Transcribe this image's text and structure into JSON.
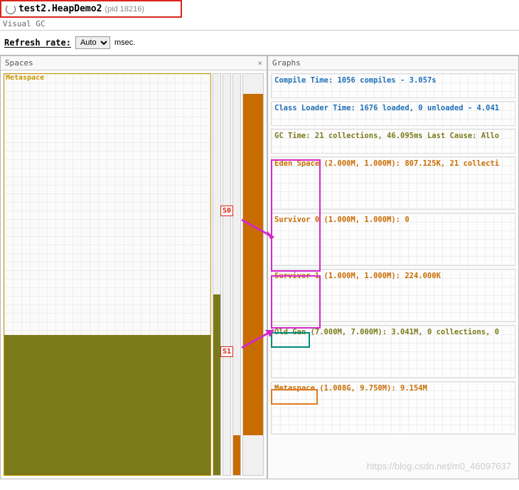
{
  "title": {
    "name": "test2.HeapDemo2",
    "pid": "(pid 18216)"
  },
  "section": "Visual GC",
  "refresh": {
    "label": "Refresh rate:",
    "value": "Auto",
    "unit": "msec."
  },
  "panels": {
    "spaces_title": "Spaces",
    "graphs_title": "Graphs",
    "metaspace_label": "Metaspace"
  },
  "labels": {
    "s0": "S0",
    "s1": "S1"
  },
  "graphs": {
    "compile": {
      "label": "Compile Time:",
      "detail": " 1056 compiles - 3.057s"
    },
    "classloader": {
      "label": "Class Loader Time:",
      "detail": " 1676 loaded, 0 unloaded - 4.041"
    },
    "gctime": {
      "label": "GC Time:",
      "detail": " 21 collections, 46.095ms Last Cause: Allo"
    },
    "eden": {
      "label": "Eden Space",
      "detail": " (2.000M, 1.000M): 807.125K, 21 collecti"
    },
    "s0": {
      "label": "Survivor 0",
      "detail": " (1.000M, 1.000M): 0"
    },
    "s1": {
      "label": "Survivor 1",
      "detail": " (1.000M, 1.000M): 224.000K"
    },
    "oldgen": {
      "label": "Old Gen",
      "detail": " (7.000M, 7.000M): 3.041M, 0 collections, 0"
    },
    "metaspace": {
      "label": "Metaspace",
      "detail": " (1.008G, 9.750M): 9.154M"
    }
  },
  "chart_data": {
    "type": "bar",
    "title": "JVM Heap Spaces",
    "series": [
      {
        "name": "Metaspace",
        "capacity_mb": 9.75,
        "used_mb": 9.154,
        "max_gb": 1.008
      },
      {
        "name": "Old Gen",
        "capacity_mb": 7.0,
        "used_mb": 3.041,
        "max_mb": 7.0,
        "collections": 0
      },
      {
        "name": "Survivor 0",
        "capacity_mb": 1.0,
        "used_kb": 0,
        "max_mb": 1.0
      },
      {
        "name": "Survivor 1",
        "capacity_mb": 1.0,
        "used_kb": 224.0,
        "max_mb": 1.0
      },
      {
        "name": "Eden Space",
        "capacity_mb": 1.0,
        "used_kb": 807.125,
        "max_mb": 2.0,
        "collections": 21
      }
    ],
    "gc": {
      "collections": 21,
      "time_ms": 46.095,
      "last_cause": "Allocation"
    },
    "compile": {
      "count": 1056,
      "time_s": 3.057
    },
    "class_loader": {
      "loaded": 1676,
      "unloaded": 0,
      "time_s": 4.041
    }
  },
  "watermark": "https://blog.csdn.net/m0_46097637"
}
